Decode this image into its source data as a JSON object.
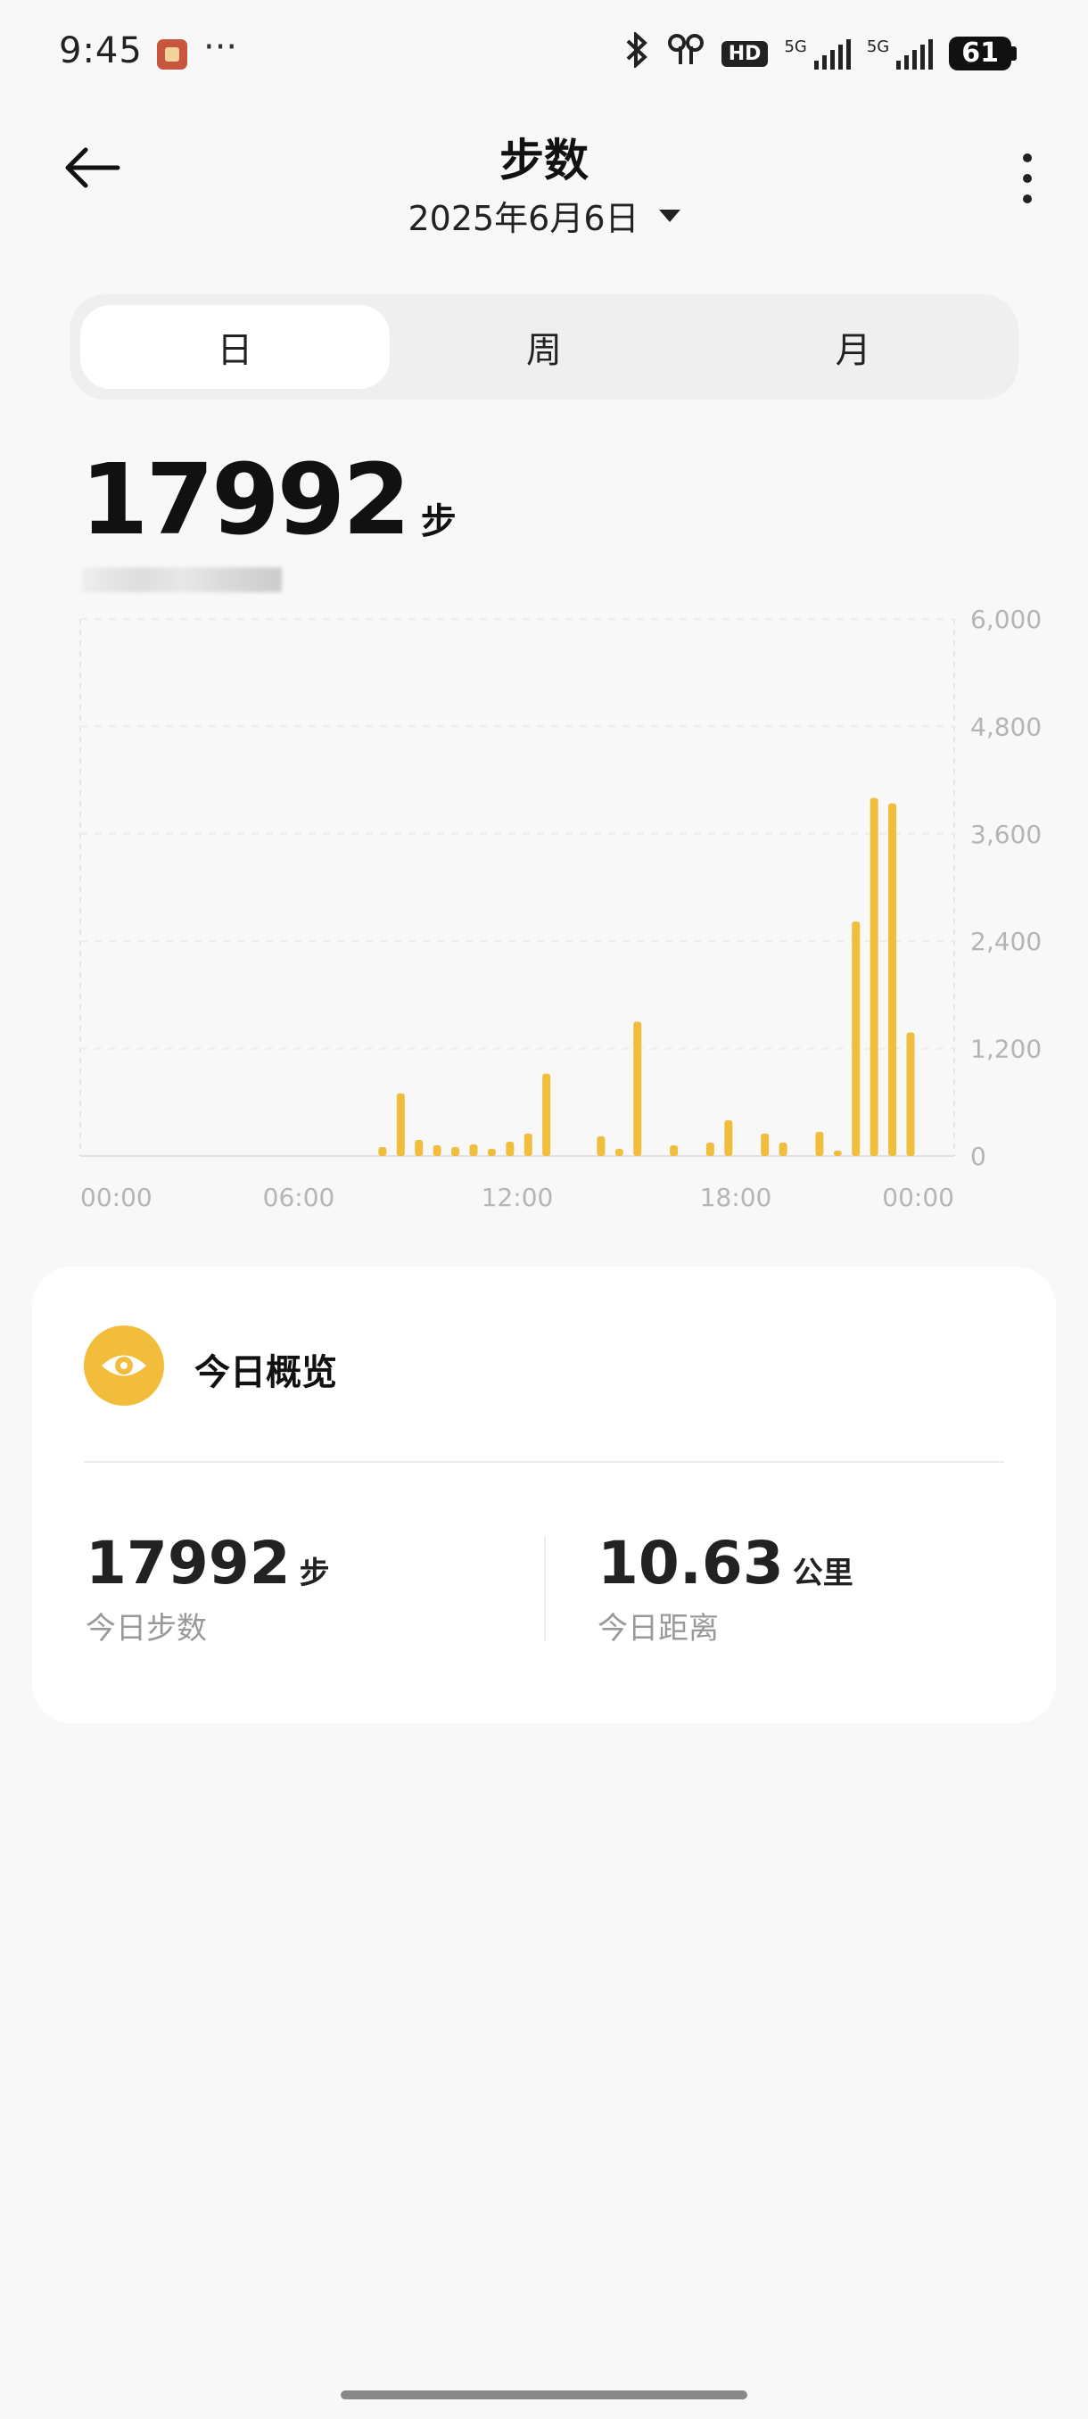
{
  "status_bar": {
    "time": "9:45",
    "more_glyph": "···",
    "hd_label": "HD",
    "signal_label_1": "5G",
    "signal_label_2": "5G",
    "battery": "61"
  },
  "header": {
    "title": "步数",
    "date": "2025年6月6日",
    "back_icon": "back-arrow-icon",
    "more_icon": "more-vertical-icon"
  },
  "tabs": [
    {
      "label": "日",
      "active": true
    },
    {
      "label": "周",
      "active": false
    },
    {
      "label": "月",
      "active": false
    }
  ],
  "summary": {
    "total_steps": "17992",
    "unit": "步"
  },
  "chart_data": {
    "type": "bar",
    "x_tick_labels": [
      "00:00",
      "06:00",
      "12:00",
      "18:00",
      "00:00"
    ],
    "y_tick_labels": [
      "6,000",
      "4,800",
      "3,600",
      "2,400",
      "1,200",
      "0"
    ],
    "ylim": [
      0,
      6000
    ],
    "x_unit": "hour of day",
    "x": [
      8.3,
      8.8,
      9.3,
      9.8,
      10.3,
      10.8,
      11.3,
      11.8,
      12.3,
      12.8,
      14.3,
      14.8,
      15.3,
      16.3,
      17.3,
      17.8,
      18.8,
      19.3,
      20.3,
      20.8,
      21.3,
      21.8,
      22.3
    ],
    "values": [
      100,
      700,
      180,
      120,
      100,
      130,
      80,
      160,
      250,
      920,
      220,
      80,
      1500,
      120,
      150,
      400,
      250,
      150,
      270,
      60,
      2620,
      4000,
      3940,
      1380
    ],
    "bar_color": "#f0be3c"
  },
  "overview": {
    "title": "今日概览",
    "icon": "eye-icon",
    "steps_value": "17992",
    "steps_unit": "步",
    "steps_label": "今日步数",
    "distance_value": "10.63",
    "distance_unit": "公里",
    "distance_label": "今日距离"
  }
}
